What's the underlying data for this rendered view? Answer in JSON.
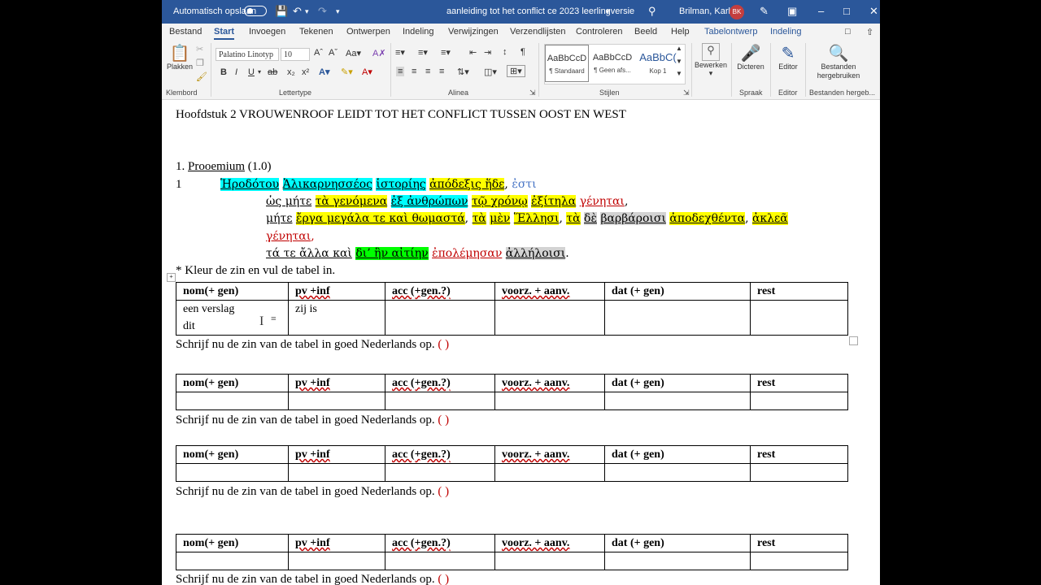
{
  "titlebar": {
    "autosave_label": "Automatisch opslaan",
    "doc_title": "aanleiding tot het conflict ce 2023 leerlingversie",
    "user_name": "Brilman, Karla",
    "user_initials": "BK"
  },
  "tabs": [
    "Bestand",
    "Start",
    "Invoegen",
    "Tekenen",
    "Ontwerpen",
    "Indeling",
    "Verwijzingen",
    "Verzendlijsten",
    "Controleren",
    "Beeld",
    "Help",
    "Tabelontwerp",
    "Indeling"
  ],
  "ribbon": {
    "paste_label": "Plakken",
    "font_name": "Palatino Linotyp",
    "font_size": "10",
    "styles": [
      {
        "preview": "AaBbCcD",
        "name": "¶ Standaard"
      },
      {
        "preview": "AaBbCcD",
        "name": "¶ Geen afs..."
      },
      {
        "preview": "AaBbC(",
        "name": "Kop 1"
      }
    ],
    "buttons": {
      "bewerken": "Bewerken",
      "dicteren": "Dicteren",
      "editor": "Editor",
      "bestanden": "Bestanden hergebruiken"
    },
    "groups": {
      "klembord": "Klembord",
      "lettertype": "Lettertype",
      "alinea": "Alinea",
      "stijlen": "Stijlen",
      "spraak": "Spraak",
      "editor": "Editor",
      "bestanden": "Bestanden hergeb..."
    }
  },
  "document": {
    "heading": "Hoofdstuk 2  VROUWENROOF LEIDT TOT HET CONFLICT TUSSEN OOST EN WEST",
    "section_number": "1.",
    "section_title": "Prooemium",
    "section_ref": "(1.0)",
    "line_number": "1",
    "greek": {
      "l1": [
        "Ἡροδότου",
        "Ἁλικαρνησσέος",
        "ἱστορίης",
        "ἀπόδεξις ἥδε",
        "ἐστι"
      ],
      "l2": [
        "ὡς μήτε",
        "τὰ γενόμενα",
        "ἐξ ἀνθρώπων",
        "τῷ χρόνῳ",
        "ἐξίτηλα",
        "γένηται"
      ],
      "l3": [
        "μήτε",
        "ἔργα μεγάλα τε καὶ θωμαστά",
        "τὰ",
        "μὲν",
        "Ἕλλησι",
        "τὰ",
        "δὲ",
        "βαρβάροισι",
        "ἀποδεχθέντα",
        "ἀκλεᾶ"
      ],
      "l4": [
        "γένηται"
      ],
      "l5": [
        "τά τε ἄλλα καὶ",
        "δι’ ἣν αἰτίην",
        "ἐπολέμησαν",
        "ἀλλήλοισι"
      ]
    },
    "instruction": "* Kleur de zin en vul de tabel in.",
    "table_headers": [
      "nom(+ gen)",
      "pv +inf",
      "acc (+gen.?)",
      "voorz. + aanv.",
      "dat (+ gen)",
      "rest"
    ],
    "first_table_cells": [
      "een verslag",
      "zij is",
      "dit"
    ],
    "write_prompt": "Schrijf nu de zin van de tabel in goed Nederlands op.",
    "paren": "(  )"
  }
}
